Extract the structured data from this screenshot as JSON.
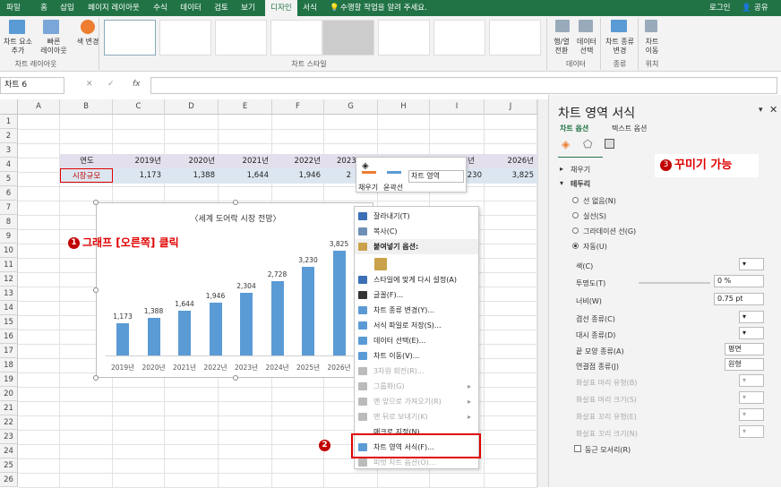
{
  "tabs": [
    "파일",
    "홈",
    "삽입",
    "페이지 레이아웃",
    "수식",
    "데이터",
    "검토",
    "보기",
    "디자인",
    "서식"
  ],
  "tell_me": "수행할 작업을 알려 주세요.",
  "login": "로그인",
  "share": "공유",
  "ribbon": {
    "add_element": "차트 요소\n추가",
    "quick_layout": "빠른\n레이아웃",
    "change_color": "색 변경",
    "layout_group": "차트 레이아웃",
    "styles_group": "차트 스타일",
    "switch_row_col": "행/열\n전환",
    "select_data": "데이터\n선택",
    "data_group": "데이터",
    "change_type": "차트 종류\n변경",
    "type_group": "종류",
    "move_chart": "차트\n이동",
    "location_group": "위치"
  },
  "formula": {
    "name_box": "차트 6",
    "fx": "fx",
    "value": ""
  },
  "columns": [
    "A",
    "B",
    "C",
    "D",
    "E",
    "F",
    "G",
    "H",
    "I",
    "J"
  ],
  "rows": [
    "1",
    "2",
    "3",
    "4",
    "5",
    "6",
    "7",
    "8",
    "9",
    "10",
    "11",
    "12",
    "13",
    "14",
    "15",
    "16",
    "17",
    "18",
    "19",
    "20",
    "21",
    "22",
    "23",
    "24",
    "25",
    "26"
  ],
  "table": {
    "header_label": "연도",
    "value_label": "시장규모",
    "years": [
      "2019년",
      "2020년",
      "2021년",
      "2022년",
      "2023",
      "2026년"
    ],
    "values": [
      "1,173",
      "1,388",
      "1,644",
      "1,946",
      "2",
      "230",
      "3,825"
    ],
    "extra_year_i": "년"
  },
  "chart_data": {
    "type": "bar",
    "title": "〈세계 도어락 시장 전망〉",
    "categories": [
      "2019년",
      "2020년",
      "2021년",
      "2022년",
      "2023년",
      "2024년",
      "2025년",
      "2026년"
    ],
    "values": [
      1173,
      1388,
      1644,
      1946,
      2304,
      2728,
      3230,
      3825
    ],
    "value_labels": [
      "1,173",
      "1,388",
      "1,644",
      "1,946",
      "2,304",
      "2,728",
      "3,230",
      "3,825"
    ],
    "ylim": [
      0,
      4000
    ],
    "color": "#5b9bd5"
  },
  "mini_toolbar": {
    "fill_label": "채우기",
    "outline_label": "윤곽선",
    "area_dropdown": "차트 영역"
  },
  "context_menu": {
    "items": [
      {
        "label": "잘라내기(T)",
        "disabled": false,
        "icon": "scissors-icon"
      },
      {
        "label": "복사(C)",
        "disabled": false,
        "icon": "copy-icon"
      },
      {
        "label": "붙여넣기 옵션:",
        "disabled": false,
        "icon": "paste-icon",
        "bold": true
      },
      {
        "label": "",
        "disabled": false,
        "icon": "clipboard-icon"
      },
      {
        "label": "스타일에 맞게 다시 설정(A)",
        "disabled": false,
        "icon": "reset-style-icon"
      },
      {
        "label": "글꼴(F)...",
        "disabled": false,
        "icon": "font-icon"
      },
      {
        "label": "차트 종류 변경(Y)...",
        "disabled": false,
        "icon": "chart-type-icon"
      },
      {
        "label": "서식 파일로 저장(S)...",
        "disabled": false,
        "icon": "template-icon"
      },
      {
        "label": "데이터 선택(E)...",
        "disabled": false,
        "icon": "select-data-icon"
      },
      {
        "label": "차트 이동(V)...",
        "disabled": false,
        "icon": "move-chart-icon"
      },
      {
        "label": "3차원 회전(R)...",
        "disabled": true,
        "icon": "rotate-3d-icon"
      },
      {
        "label": "그룹화(G)",
        "disabled": true,
        "icon": "group-icon",
        "submenu": true
      },
      {
        "label": "맨 앞으로 가져오기(R)",
        "disabled": true,
        "icon": "bring-front-icon",
        "submenu": true
      },
      {
        "label": "맨 뒤로 보내기(K)",
        "disabled": true,
        "icon": "send-back-icon",
        "submenu": true
      },
      {
        "label": "매크로 지정(N)...",
        "disabled": false,
        "icon": ""
      },
      {
        "label": "차트 영역 서식(F)...",
        "disabled": false,
        "icon": "format-area-icon"
      },
      {
        "label": "피벗 차트 옵션(O)...",
        "disabled": true,
        "icon": "pivot-icon"
      }
    ]
  },
  "pane": {
    "title": "차트 영역 서식",
    "tab_chart": "차트 옵션",
    "tab_text": "텍스트 옵션",
    "fill_section": "채우기",
    "border_section": "테두리",
    "radio": [
      "선 없음(N)",
      "실선(S)",
      "그라데이션 선(G)",
      "자동(U)"
    ],
    "color": "색(C)",
    "transparency": "투명도(T)",
    "transparency_value": "0 %",
    "width": "너비(W)",
    "width_value": "0.75 pt",
    "compound": "겹선 종류(C)",
    "dash": "대시 종류(D)",
    "cap": "끝 모양 종류(A)",
    "cap_value": "평면",
    "join": "연결점 종류(J)",
    "join_value": "원형",
    "begin_arrow": "화살표 머리 유형(B)",
    "begin_size": "화살표 머리 크기(S)",
    "end_arrow": "화살표 꼬리 유형(E)",
    "end_size": "화살표 꼬리 크기(N)",
    "rounded": "둥근 모서리(R)"
  },
  "annotations": {
    "a1": "그래프 [오른쪽] 클릭",
    "a2": "",
    "a3": "꾸미기 가능",
    "n1": "1",
    "n2": "2",
    "n3": "3"
  },
  "colors": {
    "excel_green": "#217346",
    "highlight_red": "#e00000",
    "bar": "#5b9bd5"
  }
}
